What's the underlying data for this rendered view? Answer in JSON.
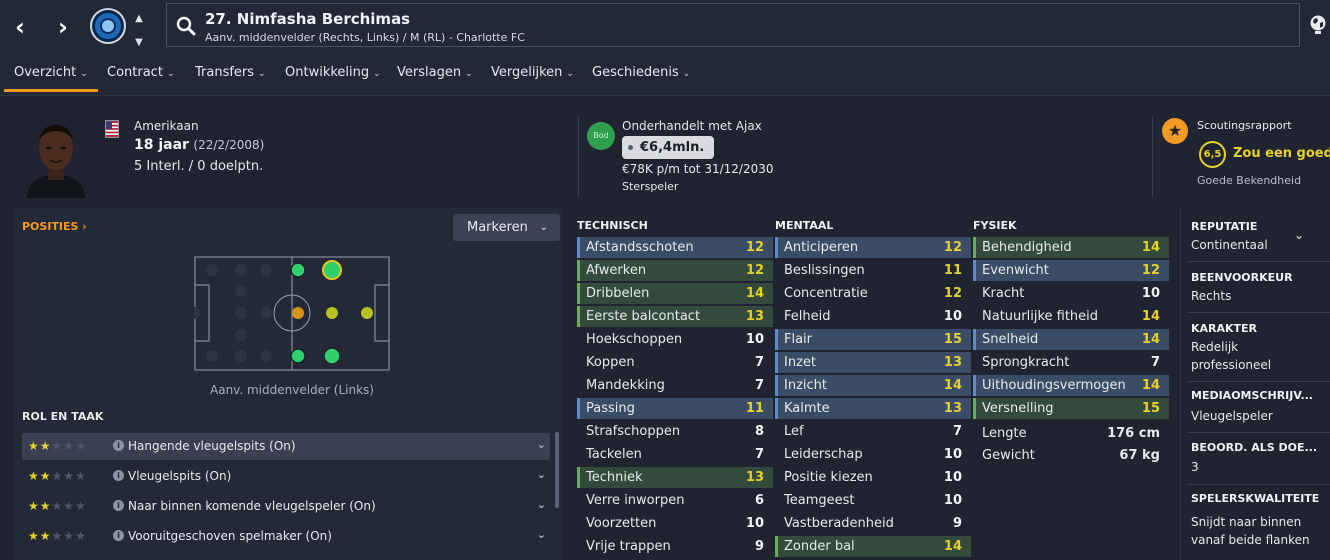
{
  "header": {
    "title": "27. Nimfasha Berchimas",
    "subtitle": "Aanv. middenvelder (Rechts, Links) / M (RL) - Charlotte FC",
    "back_icon": "chevron-left-icon",
    "forward_icon": "chevron-right-icon"
  },
  "tabs": [
    {
      "label": "Overzicht",
      "active": true
    },
    {
      "label": "Contract"
    },
    {
      "label": "Transfers"
    },
    {
      "label": "Ontwikkeling"
    },
    {
      "label": "Verslagen"
    },
    {
      "label": "Vergelijken"
    },
    {
      "label": "Geschiedenis"
    }
  ],
  "profile": {
    "nationality": "Amerikaan",
    "age": "18 jaar",
    "dob": "(22/2/2008)",
    "internationals": "5 Interl. / 0 doelptn."
  },
  "transfer": {
    "badge": "Bod",
    "status": "Onderhandelt met Ajax",
    "value": "€6,4mln.",
    "contract": "€78K p/m tot 31/12/2030",
    "player_status": "Sterspeler"
  },
  "scouting": {
    "title": "Scoutingsrapport",
    "rating": "6,5",
    "summary": "Zou een goede a",
    "knowledge": "Goede Bekendheid"
  },
  "positions": {
    "label": "POSITIES",
    "highlight_button": "Markeren",
    "caption": "Aanv. middenvelder (Links)"
  },
  "roles": {
    "label": "ROL EN TAAK",
    "items": [
      {
        "name": "Hangende vleugelspits (On)",
        "stars": 2
      },
      {
        "name": "Vleugelspits (On)",
        "stars": 2
      },
      {
        "name": "Naar binnen komende vleugelspeler (On)",
        "stars": 2
      },
      {
        "name": "Vooruitgeschoven spelmaker (On)",
        "stars": 2
      }
    ]
  },
  "attributes": {
    "technical": {
      "label": "TECHNISCH",
      "items": [
        {
          "name": "Afstandsschoten",
          "value": "12",
          "hl": "blue"
        },
        {
          "name": "Afwerken",
          "value": "12",
          "hl": "green"
        },
        {
          "name": "Dribbelen",
          "value": "14",
          "hl": "green"
        },
        {
          "name": "Eerste balcontact",
          "value": "13",
          "hl": "green"
        },
        {
          "name": "Hoekschoppen",
          "value": "10",
          "hl": ""
        },
        {
          "name": "Koppen",
          "value": "7",
          "hl": ""
        },
        {
          "name": "Mandekking",
          "value": "7",
          "hl": ""
        },
        {
          "name": "Passing",
          "value": "11",
          "hl": "blue"
        },
        {
          "name": "Strafschoppen",
          "value": "8",
          "hl": ""
        },
        {
          "name": "Tackelen",
          "value": "7",
          "hl": ""
        },
        {
          "name": "Techniek",
          "value": "13",
          "hl": "green"
        },
        {
          "name": "Verre inworpen",
          "value": "6",
          "hl": ""
        },
        {
          "name": "Voorzetten",
          "value": "10",
          "hl": ""
        },
        {
          "name": "Vrije trappen",
          "value": "9",
          "hl": ""
        }
      ]
    },
    "mental": {
      "label": "MENTAAL",
      "items": [
        {
          "name": "Anticiperen",
          "value": "12",
          "hl": "blue"
        },
        {
          "name": "Beslissingen",
          "value": "11",
          "hl": ""
        },
        {
          "name": "Concentratie",
          "value": "12",
          "hl": ""
        },
        {
          "name": "Felheid",
          "value": "10",
          "hl": ""
        },
        {
          "name": "Flair",
          "value": "15",
          "hl": "blue"
        },
        {
          "name": "Inzet",
          "value": "13",
          "hl": "blue"
        },
        {
          "name": "Inzicht",
          "value": "14",
          "hl": "blue"
        },
        {
          "name": "Kalmte",
          "value": "13",
          "hl": "blue"
        },
        {
          "name": "Lef",
          "value": "7",
          "hl": ""
        },
        {
          "name": "Leiderschap",
          "value": "10",
          "hl": ""
        },
        {
          "name": "Positie kiezen",
          "value": "10",
          "hl": ""
        },
        {
          "name": "Teamgeest",
          "value": "10",
          "hl": ""
        },
        {
          "name": "Vastberadenheid",
          "value": "9",
          "hl": ""
        },
        {
          "name": "Zonder bal",
          "value": "14",
          "hl": "green"
        }
      ]
    },
    "physical": {
      "label": "FYSIEK",
      "items": [
        {
          "name": "Behendigheid",
          "value": "14",
          "hl": "green"
        },
        {
          "name": "Evenwicht",
          "value": "12",
          "hl": "blue"
        },
        {
          "name": "Kracht",
          "value": "10",
          "hl": ""
        },
        {
          "name": "Natuurlijke fitheid",
          "value": "14",
          "hl": ""
        },
        {
          "name": "Snelheid",
          "value": "14",
          "hl": "blue"
        },
        {
          "name": "Sprongkracht",
          "value": "7",
          "hl": ""
        },
        {
          "name": "Uithoudingsvermogen",
          "value": "14",
          "hl": "blue"
        },
        {
          "name": "Versnelling",
          "value": "15",
          "hl": "green"
        }
      ],
      "height_label": "Lengte",
      "height": "176 cm",
      "weight_label": "Gewicht",
      "weight": "67 kg"
    }
  },
  "info": {
    "reputation_label": "REPUTATIE",
    "reputation": "Continentaal",
    "foot_label": "BEENVOORKEUR",
    "foot": "Rechts",
    "character_label": "KARAKTER",
    "character_1": "Redelijk",
    "character_2": "professioneel",
    "media_label": "MEDIAOMSCHRIJV...",
    "media": "Vleugelspeler",
    "rating_label": "BEOORD. ALS DOE...",
    "rating": "3",
    "traits_label": "SPELERSKWALITEITE",
    "trait_1": "Snijdt naar binnen",
    "trait_2": "vanaf beide flanken"
  },
  "colors": {
    "accent": "#f29b22",
    "high_value": "#e6d22a",
    "positive_value": "#9fd96e",
    "blue_highlight": "#3b4d66",
    "green_highlight": "#344a3d"
  }
}
